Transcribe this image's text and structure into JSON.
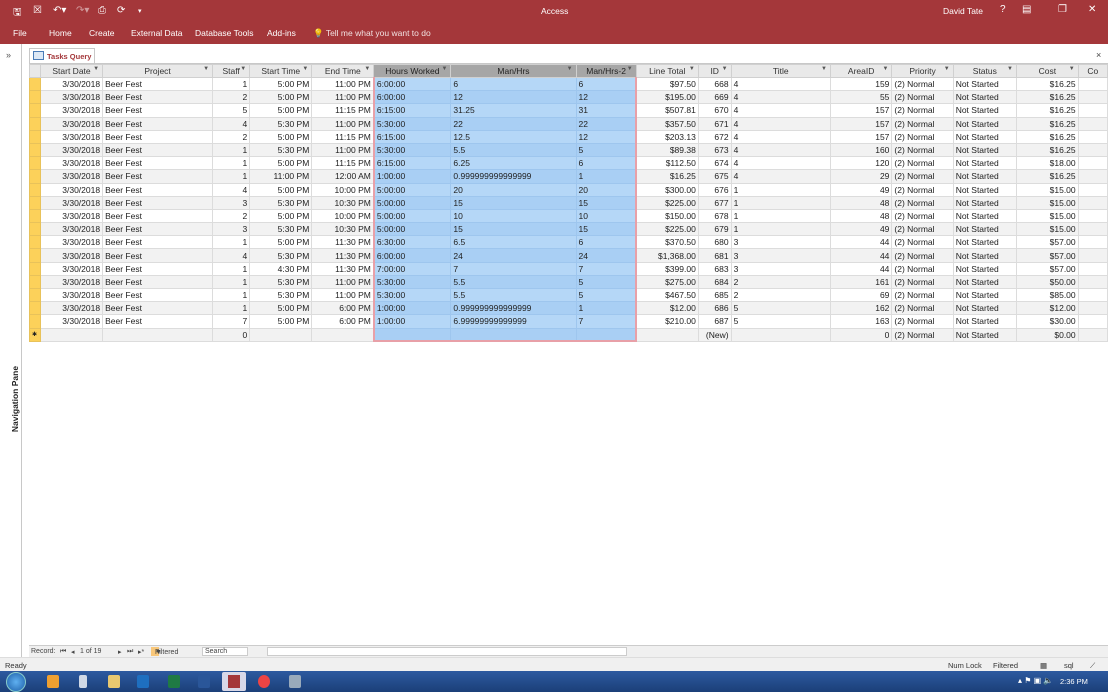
{
  "titlebar": {
    "app": "Access",
    "user": "David Tate",
    "help": "?",
    "quick_access": [
      "save-icon",
      "close-db-icon",
      "undo-icon",
      "redo-icon",
      "print-preview-icon",
      "sync-icon",
      "customize-icon"
    ]
  },
  "ribbon": {
    "tabs": [
      "File",
      "Home",
      "Create",
      "External Data",
      "Database Tools",
      "Add-ins"
    ],
    "tell_me": "Tell me what you want to do"
  },
  "nav_pane": {
    "label": "Navigation Pane",
    "toggle": "»"
  },
  "document": {
    "tab": "Tasks Query",
    "close": "×"
  },
  "columns": [
    "Start Date",
    "Project",
    "Staff",
    "Start Time",
    "End Time",
    "Hours Worked",
    "Man/Hrs",
    "Man/Hrs-2",
    "Line Total",
    "ID",
    "Title",
    "AreaID",
    "Priority",
    "Status",
    "Cost",
    "Co"
  ],
  "rows": [
    [
      "3/30/2018",
      "Beer Fest",
      "1",
      "5:00 PM",
      "11:00 PM",
      "6:00:00",
      "6",
      "6",
      "$97.50",
      "668",
      "4",
      "159",
      "(2) Normal",
      "Not Started",
      "$16.25"
    ],
    [
      "3/30/2018",
      "Beer Fest",
      "2",
      "5:00 PM",
      "11:00 PM",
      "6:00:00",
      "12",
      "12",
      "$195.00",
      "669",
      "4",
      "55",
      "(2) Normal",
      "Not Started",
      "$16.25"
    ],
    [
      "3/30/2018",
      "Beer Fest",
      "5",
      "5:00 PM",
      "11:15 PM",
      "6:15:00",
      "31.25",
      "31",
      "$507.81",
      "670",
      "4",
      "157",
      "(2) Normal",
      "Not Started",
      "$16.25"
    ],
    [
      "3/30/2018",
      "Beer Fest",
      "4",
      "5:30 PM",
      "11:00 PM",
      "5:30:00",
      "22",
      "22",
      "$357.50",
      "671",
      "4",
      "157",
      "(2) Normal",
      "Not Started",
      "$16.25"
    ],
    [
      "3/30/2018",
      "Beer Fest",
      "2",
      "5:00 PM",
      "11:15 PM",
      "6:15:00",
      "12.5",
      "12",
      "$203.13",
      "672",
      "4",
      "157",
      "(2) Normal",
      "Not Started",
      "$16.25"
    ],
    [
      "3/30/2018",
      "Beer Fest",
      "1",
      "5:30 PM",
      "11:00 PM",
      "5:30:00",
      "5.5",
      "5",
      "$89.38",
      "673",
      "4",
      "160",
      "(2) Normal",
      "Not Started",
      "$16.25"
    ],
    [
      "3/30/2018",
      "Beer Fest",
      "1",
      "5:00 PM",
      "11:15 PM",
      "6:15:00",
      "6.25",
      "6",
      "$112.50",
      "674",
      "4",
      "120",
      "(2) Normal",
      "Not Started",
      "$18.00"
    ],
    [
      "3/30/2018",
      "Beer Fest",
      "1",
      "11:00 PM",
      "12:00 AM",
      "1:00:00",
      "0.999999999999999",
      "1",
      "$16.25",
      "675",
      "4",
      "29",
      "(2) Normal",
      "Not Started",
      "$16.25"
    ],
    [
      "3/30/2018",
      "Beer Fest",
      "4",
      "5:00 PM",
      "10:00 PM",
      "5:00:00",
      "20",
      "20",
      "$300.00",
      "676",
      "1",
      "49",
      "(2) Normal",
      "Not Started",
      "$15.00"
    ],
    [
      "3/30/2018",
      "Beer Fest",
      "3",
      "5:30 PM",
      "10:30 PM",
      "5:00:00",
      "15",
      "15",
      "$225.00",
      "677",
      "1",
      "48",
      "(2) Normal",
      "Not Started",
      "$15.00"
    ],
    [
      "3/30/2018",
      "Beer Fest",
      "2",
      "5:00 PM",
      "10:00 PM",
      "5:00:00",
      "10",
      "10",
      "$150.00",
      "678",
      "1",
      "48",
      "(2) Normal",
      "Not Started",
      "$15.00"
    ],
    [
      "3/30/2018",
      "Beer Fest",
      "3",
      "5:30 PM",
      "10:30 PM",
      "5:00:00",
      "15",
      "15",
      "$225.00",
      "679",
      "1",
      "49",
      "(2) Normal",
      "Not Started",
      "$15.00"
    ],
    [
      "3/30/2018",
      "Beer Fest",
      "1",
      "5:00 PM",
      "11:30 PM",
      "6:30:00",
      "6.5",
      "6",
      "$370.50",
      "680",
      "3",
      "44",
      "(2) Normal",
      "Not Started",
      "$57.00"
    ],
    [
      "3/30/2018",
      "Beer Fest",
      "4",
      "5:30 PM",
      "11:30 PM",
      "6:00:00",
      "24",
      "24",
      "$1,368.00",
      "681",
      "3",
      "44",
      "(2) Normal",
      "Not Started",
      "$57.00"
    ],
    [
      "3/30/2018",
      "Beer Fest",
      "1",
      "4:30 PM",
      "11:30 PM",
      "7:00:00",
      "7",
      "7",
      "$399.00",
      "683",
      "3",
      "44",
      "(2) Normal",
      "Not Started",
      "$57.00"
    ],
    [
      "3/30/2018",
      "Beer Fest",
      "1",
      "5:30 PM",
      "11:00 PM",
      "5:30:00",
      "5.5",
      "5",
      "$275.00",
      "684",
      "2",
      "161",
      "(2) Normal",
      "Not Started",
      "$50.00"
    ],
    [
      "3/30/2018",
      "Beer Fest",
      "1",
      "5:30 PM",
      "11:00 PM",
      "5:30:00",
      "5.5",
      "5",
      "$467.50",
      "685",
      "2",
      "69",
      "(2) Normal",
      "Not Started",
      "$85.00"
    ],
    [
      "3/30/2018",
      "Beer Fest",
      "1",
      "5:00 PM",
      "6:00 PM",
      "1:00:00",
      "0.999999999999999",
      "1",
      "$12.00",
      "686",
      "5",
      "162",
      "(2) Normal",
      "Not Started",
      "$12.00"
    ],
    [
      "3/30/2018",
      "Beer Fest",
      "7",
      "5:00 PM",
      "6:00 PM",
      "1:00:00",
      "6.99999999999999",
      "7",
      "$210.00",
      "687",
      "5",
      "163",
      "(2) Normal",
      "Not Started",
      "$30.00"
    ]
  ],
  "new_row": [
    "",
    "",
    "0",
    "",
    "",
    "",
    "",
    "",
    "",
    "(New)",
    "",
    "0",
    "(2) Normal",
    "Not Started",
    "$0.00"
  ],
  "record_nav": {
    "label": "Record:",
    "position": "1 of 19",
    "filter": "Filtered",
    "search": "Search"
  },
  "status": {
    "left": "Ready",
    "num_lock": "Num Lock",
    "filtered": "Filtered"
  },
  "taskbar": {
    "clock": "2:36 PM",
    "apps": [
      "media-player",
      "file",
      "explorer",
      "outlook",
      "excel",
      "word",
      "access",
      "chrome",
      "other"
    ]
  },
  "colors": {
    "brand": "#a4373a",
    "selection": "#b5d7f7",
    "row_selector": "#fcd15a"
  }
}
